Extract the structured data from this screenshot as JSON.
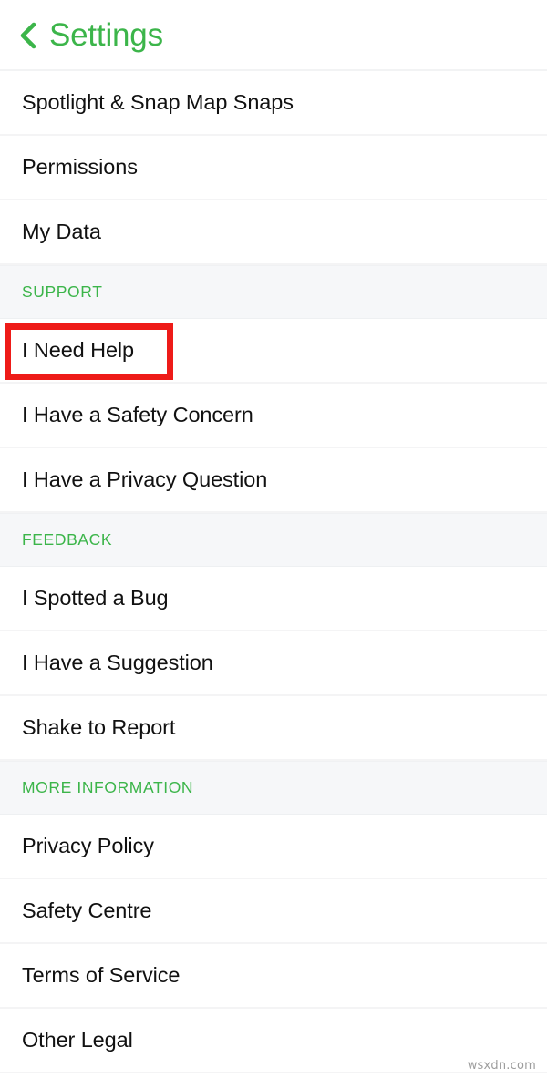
{
  "header": {
    "back_icon": "chevron-left-icon",
    "title": "Settings",
    "accent_color": "#3cb54a"
  },
  "list": [
    {
      "kind": "row",
      "label": "Spotlight & Snap Map Snaps"
    },
    {
      "kind": "row",
      "label": "Permissions"
    },
    {
      "kind": "row",
      "label": "My Data"
    },
    {
      "kind": "section",
      "label": "SUPPORT"
    },
    {
      "kind": "row",
      "label": "I Need Help",
      "highlighted": true
    },
    {
      "kind": "row",
      "label": "I Have a Safety Concern"
    },
    {
      "kind": "row",
      "label": "I Have a Privacy Question"
    },
    {
      "kind": "section",
      "label": "FEEDBACK"
    },
    {
      "kind": "row",
      "label": "I Spotted a Bug"
    },
    {
      "kind": "row",
      "label": "I Have a Suggestion"
    },
    {
      "kind": "row",
      "label": "Shake to Report"
    },
    {
      "kind": "section",
      "label": "MORE INFORMATION"
    },
    {
      "kind": "row",
      "label": "Privacy Policy"
    },
    {
      "kind": "row",
      "label": "Safety Centre"
    },
    {
      "kind": "row",
      "label": "Terms of Service"
    },
    {
      "kind": "row",
      "label": "Other Legal"
    }
  ],
  "annotation": {
    "target": "I Need Help",
    "color": "#ee1b18"
  },
  "watermark": {
    "text": "wsxdn.com"
  }
}
